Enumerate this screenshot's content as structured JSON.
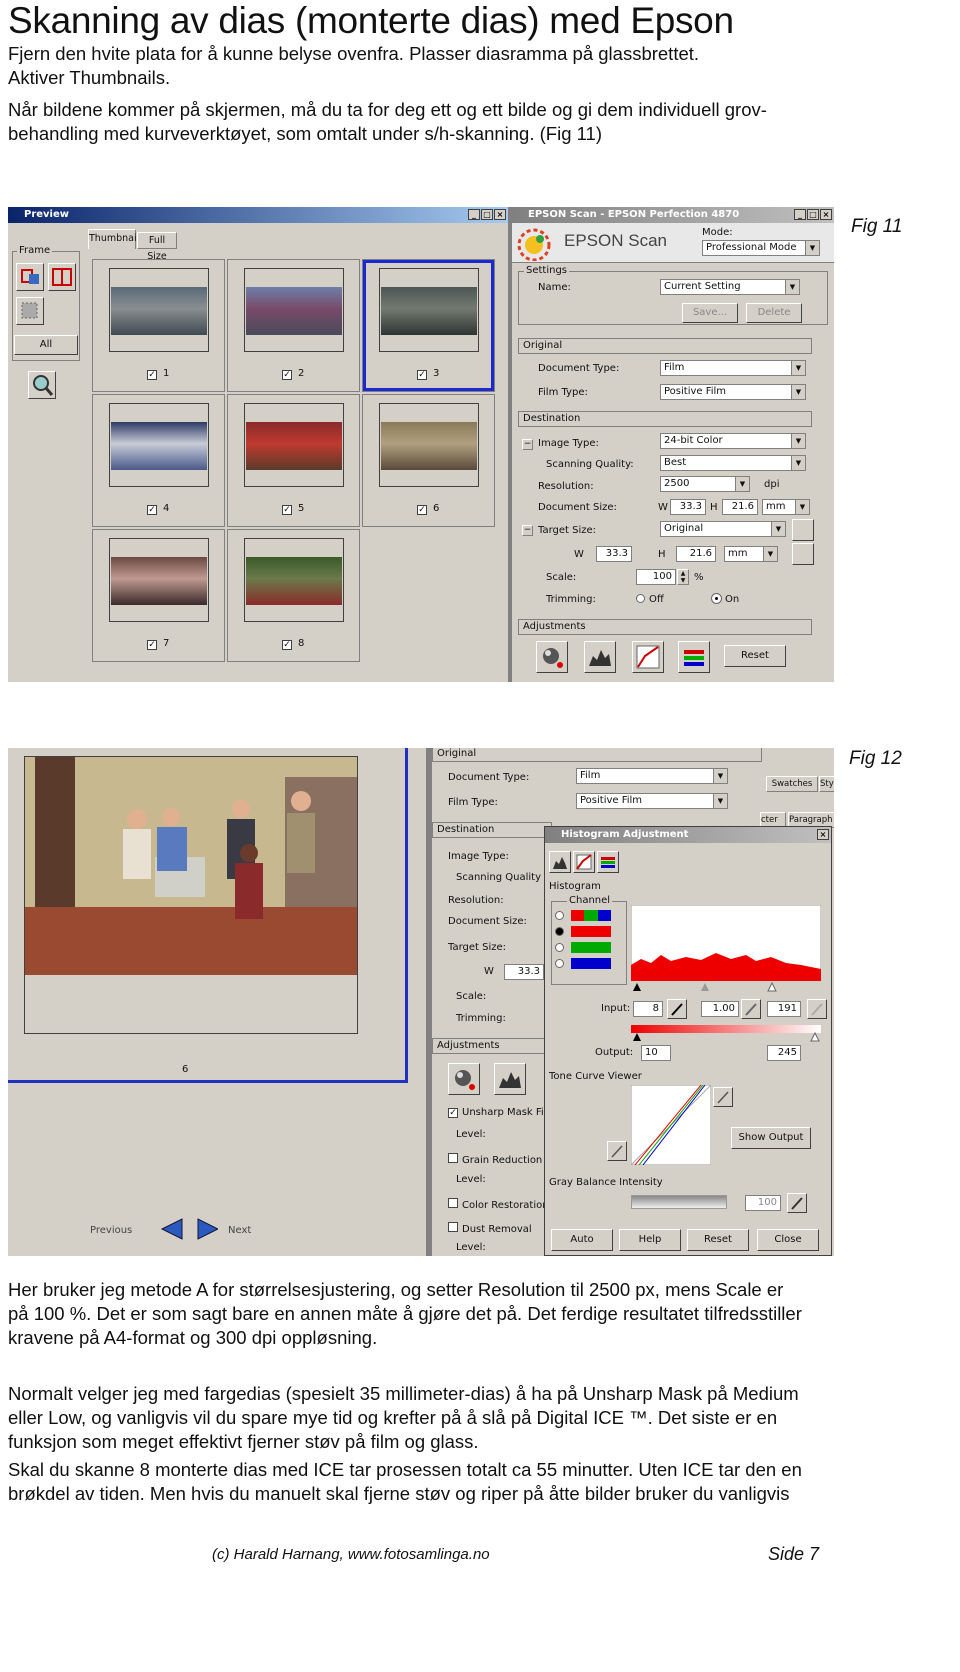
{
  "title": "Skanning av dias (monterte dias) med Epson",
  "intro": [
    "Fjern den hvite plata for å kunne belyse ovenfra. Plasser diasramma på glassbrettet.",
    "Aktiver Thumbnails.",
    "Når bildene kommer på skjermen, må du ta for deg ett og ett bilde og gi dem individuell grov-",
    "behandling med kurveverktøyet, som omtalt under s/h-skanning. (Fig 11)"
  ],
  "fig11": {
    "label": "Fig 11",
    "preview": {
      "title": "Preview",
      "frame_label": "Frame",
      "all_button": "All",
      "tabs": [
        "Thumbnail",
        "Full Size"
      ],
      "thumbnails": [
        {
          "num": "1",
          "checked": true,
          "selected": false,
          "colors": [
            "#5a6a78",
            "#8a8e90",
            "#3e4a52"
          ]
        },
        {
          "num": "2",
          "checked": true,
          "selected": false,
          "colors": [
            "#6d7fa8",
            "#7a4a6a",
            "#4a4a5a"
          ]
        },
        {
          "num": "3",
          "checked": true,
          "selected": true,
          "colors": [
            "#4e5656",
            "#727a70",
            "#2e3434"
          ]
        },
        {
          "num": "4",
          "checked": true,
          "selected": false,
          "colors": [
            "#2e3a66",
            "#c8ccd6",
            "#4a5a8a"
          ]
        },
        {
          "num": "5",
          "checked": true,
          "selected": false,
          "colors": [
            "#8a2a2a",
            "#c03a30",
            "#5a3a2a"
          ]
        },
        {
          "num": "6",
          "checked": true,
          "selected": false,
          "colors": [
            "#8a7a5a",
            "#b0a080",
            "#5a4a3a"
          ]
        },
        {
          "num": "7",
          "checked": true,
          "selected": false,
          "colors": [
            "#6a4a44",
            "#c09a90",
            "#3a2a2a"
          ]
        },
        {
          "num": "8",
          "checked": true,
          "selected": false,
          "colors": [
            "#3a5a2a",
            "#6a7a4a",
            "#8a2a2a"
          ]
        }
      ]
    },
    "epson": {
      "title": "EPSON Scan - EPSON Perfection 4870",
      "brand": "EPSON Scan",
      "mode_label": "Mode:",
      "mode_value": "Professional Mode",
      "settings_label": "Settings",
      "name_label": "Name:",
      "name_value": "Current Setting",
      "save_btn": "Save...",
      "delete_btn": "Delete",
      "original_label": "Original",
      "doc_type_label": "Document Type:",
      "doc_type_value": "Film",
      "film_type_label": "Film Type:",
      "film_type_value": "Positive Film",
      "destination_label": "Destination",
      "image_type_label": "Image Type:",
      "image_type_value": "24-bit Color",
      "quality_label": "Scanning Quality:",
      "quality_value": "Best",
      "resolution_label": "Resolution:",
      "resolution_value": "2500",
      "dpi": "dpi",
      "doc_size_label": "Document Size:",
      "w_label": "W",
      "h_label": "H",
      "doc_w": "33.3",
      "doc_h": "21.6",
      "unit": "mm",
      "target_size_label": "Target Size:",
      "target_size_value": "Original",
      "target_w": "33.3",
      "target_h": "21.6",
      "scale_label": "Scale:",
      "scale_value": "100",
      "percent": "%",
      "trimming_label": "Trimming:",
      "off": "Off",
      "on": "On",
      "adjustments_label": "Adjustments",
      "reset_btn": "Reset"
    }
  },
  "fig12": {
    "label": "Fig 12",
    "preview_num": "6",
    "previous": "Previous",
    "next": "Next",
    "settings": {
      "original": "Original",
      "doc_type_label": "Document Type:",
      "doc_type_value": "Film",
      "film_type_label": "Film Type:",
      "film_type_value": "Positive Film",
      "destination": "Destination",
      "image_type": "Image Type:",
      "quality": "Scanning Quality",
      "resolution": "Resolution:",
      "doc_size": "Document Size:",
      "target_size": "Target Size:",
      "w_label": "W",
      "w_value": "33.3",
      "scale": "Scale:",
      "trimming": "Trimming:",
      "adjustments": "Adjustments",
      "unsharp": "Unsharp Mask Filte",
      "level1": "Level:",
      "grain": "Grain Reduction",
      "level2": "Level:",
      "color_restoration": "Color Restoration",
      "dust": "Dust Removal",
      "level3": "Level:"
    },
    "side_tabs": [
      "Swatches",
      "Sty",
      "cter",
      "Paragraph"
    ],
    "histogram": {
      "title": "Histogram Adjustment",
      "histogram_label": "Histogram",
      "channel_label": "Channel",
      "input_label": "Input:",
      "input_values": [
        "8",
        "1.00",
        "191"
      ],
      "output_label": "Output:",
      "output_values": [
        "10",
        "245"
      ],
      "tone_curve_label": "Tone Curve Viewer",
      "show_output_btn": "Show Output",
      "gray_balance_label": "Gray Balance Intensity",
      "gray_value": "100",
      "buttons": [
        "Auto",
        "Help",
        "Reset",
        "Close"
      ]
    }
  },
  "para1": [
    "Her bruker jeg metode A for størrelsesjustering, og setter Resolution til 2500 px, mens Scale er",
    "på 100 %. Det er som sagt bare en annen måte å gjøre det på. Det ferdige resultatet tilfredsstiller",
    "kravene på A4-format og 300 dpi oppløsning."
  ],
  "para2": [
    "Normalt velger jeg med fargedias (spesielt 35 millimeter-dias) å ha på Unsharp Mask på Medium",
    "eller Low, og vanligvis vil du spare mye tid og krefter på å slå på Digital ICE ™. Det siste er en",
    "funksjon som meget effektivt fjerner støv på film og glass."
  ],
  "para3": [
    "Skal du skanne 8 monterte dias med ICE tar prosessen totalt ca 55 minutter. Uten ICE tar den en",
    "brøkdel av tiden. Men hvis du manuelt skal fjerne støv og riper på åtte bilder bruker du vanligvis"
  ],
  "footer": {
    "credit": "(c) Harald Harnang, www.fotosamlinga.no",
    "page": "Side 7"
  }
}
